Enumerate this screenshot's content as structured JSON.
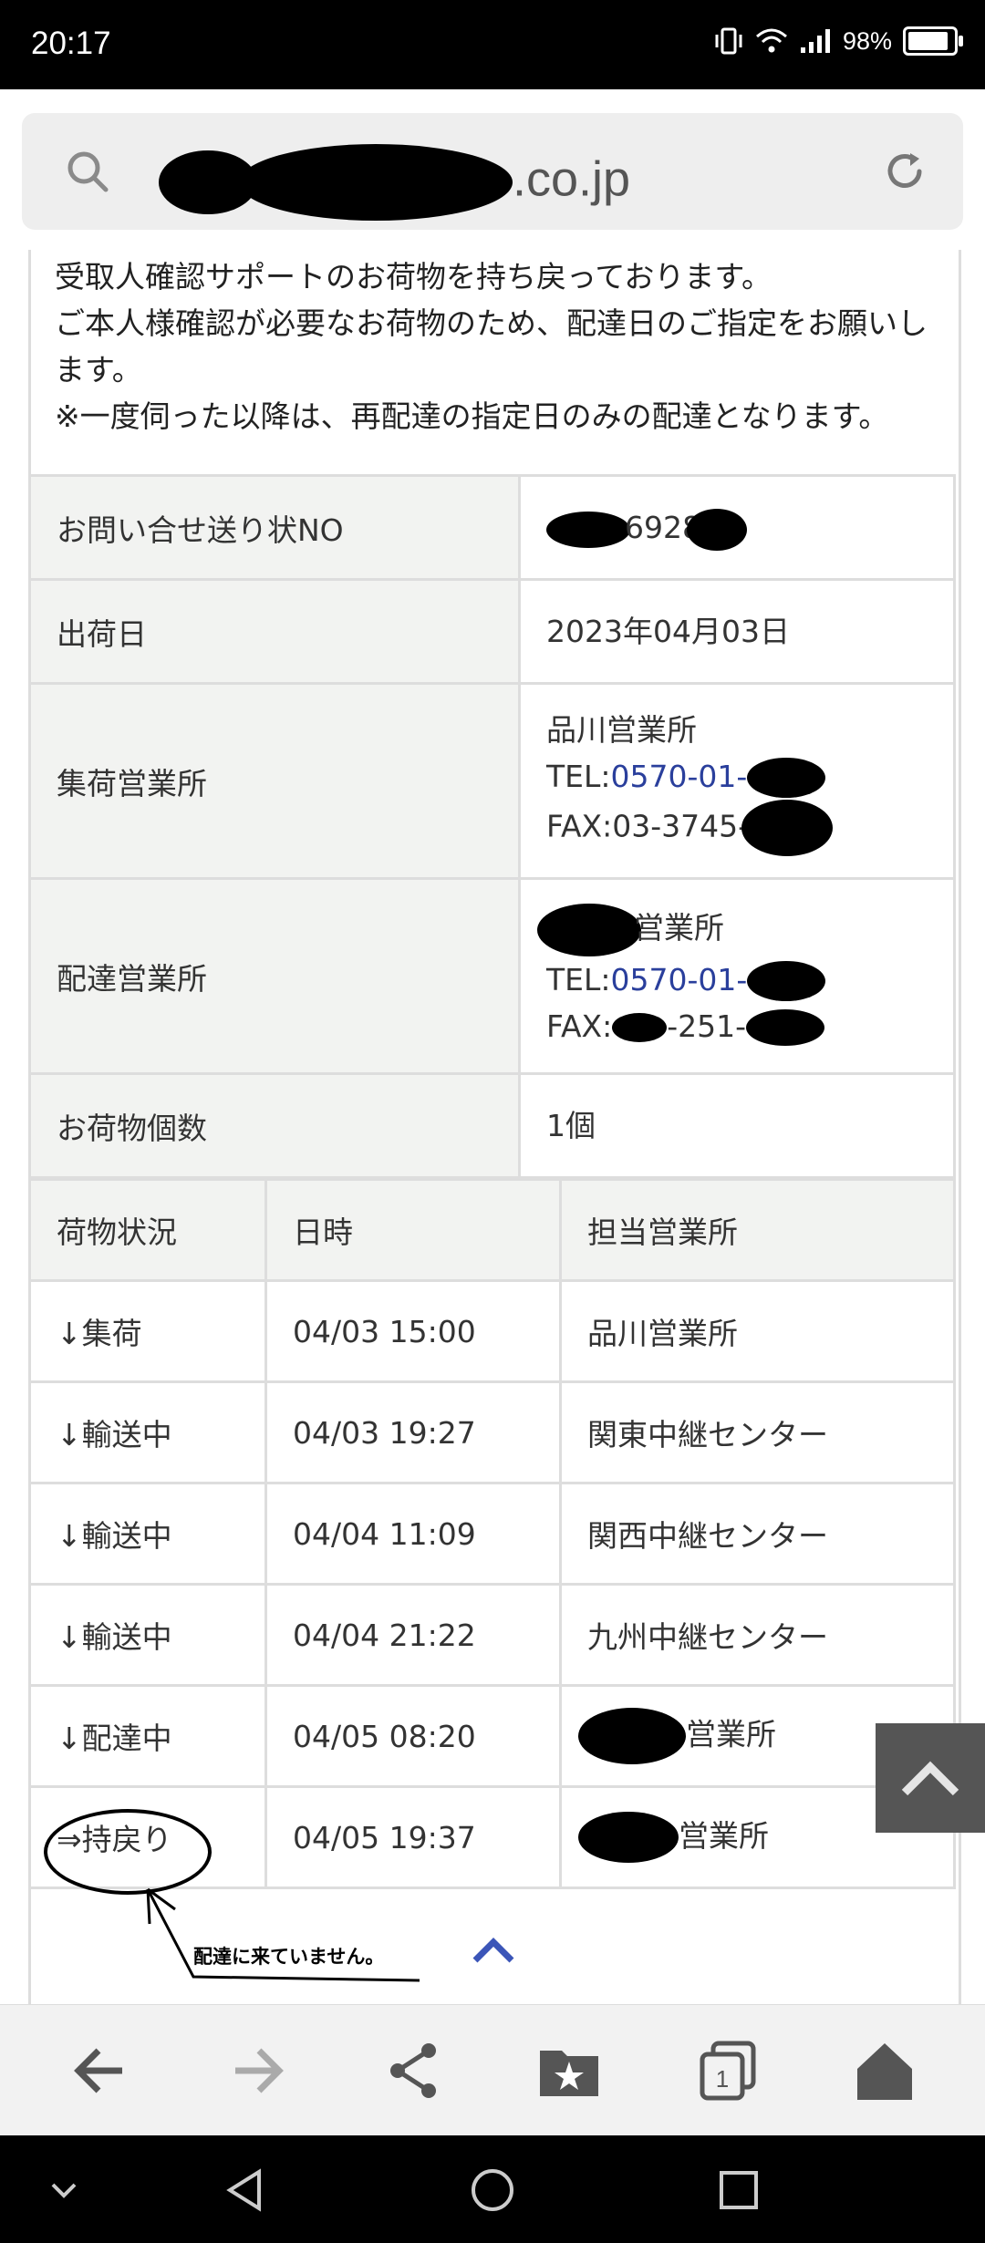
{
  "status_bar": {
    "time": "20:17",
    "battery": "98%"
  },
  "address_bar": {
    "domain_suffix": ".co.jp"
  },
  "notice": {
    "lines": [
      "受取人確認サポートのお荷物を持ち戻っております。",
      "ご本人様確認が必要なお荷物のため、配達日のご指定をお願いします。",
      "※一度伺った以降は、再配達の指定日のみの配達となります。"
    ]
  },
  "info": {
    "tracking_label": "お問い合せ送り状NO",
    "tracking_value": "6928",
    "ship_date_label": "出荷日",
    "ship_date_value": "2023年04月03日",
    "pickup_office_label": "集荷営業所",
    "pickup_office_name": "品川営業所",
    "pickup_tel_prefix": "TEL:",
    "pickup_tel": "0570-01-",
    "pickup_fax": "FAX:03-3745-",
    "delivery_office_label": "配達営業所",
    "delivery_office_name": "営業所",
    "delivery_tel_prefix": "TEL:",
    "delivery_tel": "0570-01-",
    "delivery_fax_prefix": "FAX:",
    "delivery_fax_mid": "-251-",
    "count_label": "お荷物個数",
    "count_value": "1個"
  },
  "tracking": {
    "headers": [
      "荷物状況",
      "日時",
      "担当営業所"
    ],
    "rows": [
      {
        "status": "↓集荷",
        "datetime": "04/03 15:00",
        "office": "品川営業所"
      },
      {
        "status": "↓輸送中",
        "datetime": "04/03 19:27",
        "office": "関東中継センター"
      },
      {
        "status": "↓輸送中",
        "datetime": "04/04 11:09",
        "office": "関西中継センター"
      },
      {
        "status": "↓輸送中",
        "datetime": "04/04 21:22",
        "office": "九州中継センター"
      },
      {
        "status": "↓配達中",
        "datetime": "04/05 08:20",
        "office": "営業所"
      },
      {
        "status": "⇒持戻り",
        "datetime": "04/05 19:37",
        "office": "営業所"
      }
    ]
  },
  "annotation": {
    "text": "配達に来ていません。"
  },
  "colors": {
    "link": "#2a3f9c",
    "header_bg": "#f2f3f1",
    "border": "#dddddd"
  },
  "icons": [
    "search-icon",
    "reload-icon",
    "back-icon",
    "forward-icon",
    "share-icon",
    "bookmark-icon",
    "tabs-icon",
    "home-icon",
    "scroll-top-icon",
    "chevron-up-icon"
  ],
  "toolbar": {
    "tab_count": "1"
  }
}
